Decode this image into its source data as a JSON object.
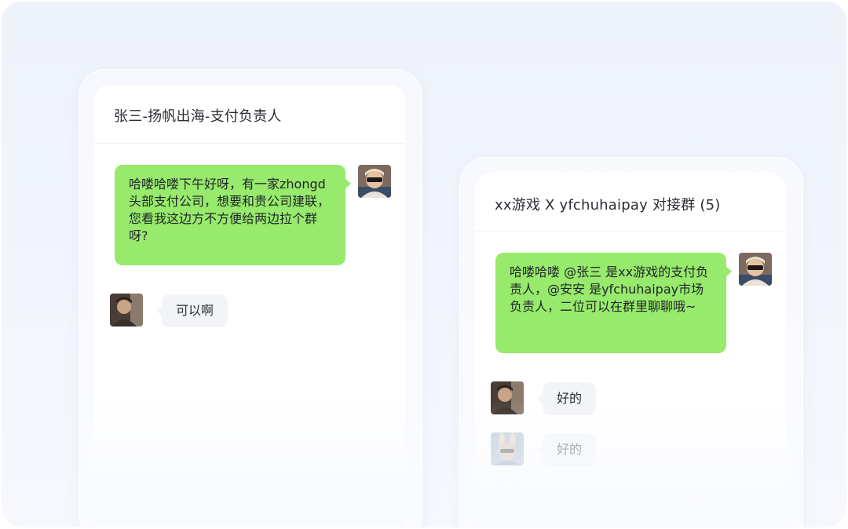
{
  "chat_left": {
    "title": "张三-扬帆出海-支付负责人",
    "messages": [
      {
        "from": "me",
        "text": "哈喽哈喽下午好呀，有一家zhongd头部支付公司，想要和贵公司建联，您看我这边方不方便给两边拉个群呀?"
      },
      {
        "from": "other",
        "text": "可以啊"
      }
    ]
  },
  "chat_right": {
    "title": "xx游戏 X yfchuhaipay 对接群 (5)",
    "messages": [
      {
        "from": "me",
        "text": "哈喽哈喽  @张三 是xx游戏的支付负责人，@安安 是yfchuhaipay市场负责人，二位可以在群里聊聊哦~"
      },
      {
        "from": "other",
        "text": "好的"
      },
      {
        "from": "other",
        "text": "好的"
      }
    ]
  },
  "colors": {
    "sent_bubble": "#97ea6b",
    "received_bubble": "#f2f4f8",
    "background": "#eef2fb"
  },
  "icons": [
    "user-avatar-sunglasses",
    "user-avatar-dark",
    "user-avatar-rabbit"
  ]
}
